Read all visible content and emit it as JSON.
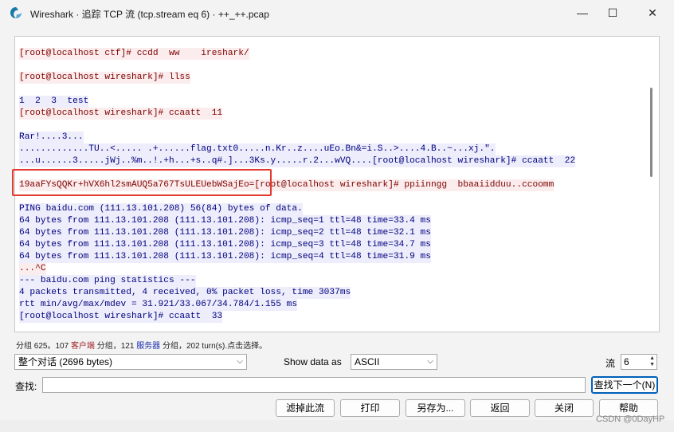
{
  "window": {
    "title": "Wireshark · 追踪 TCP 流 (tcp.stream eq 6) · ++_++.pcap",
    "minimize_glyph": "—",
    "maximize_glyph": "☐",
    "close_glyph": "✕"
  },
  "stream": {
    "lines": [
      {
        "text": "[root@localhost ctf]# ccdd  ww    ireshark/",
        "side": "client"
      },
      {
        "text": "[root@localhost wireshark]# llss",
        "side": "client"
      },
      {
        "text": "1  2  3  test",
        "side": "server"
      },
      {
        "text": "[root@localhost wireshark]# ccaatt  11",
        "side": "client"
      },
      {
        "text": "Rar!....3...",
        "side": "server"
      },
      {
        "text": ".............TU..<..... .+......flag.txt0.....n.Kr..z....uEo.Bn&=i.S..>....4.B..~...xj.\".",
        "side": "server"
      },
      {
        "text": "...u......3.....jWj..%m..!.+h...+s..q#.]...3Ks.y.....r.2...wVQ....[root@localhost wireshark]# ccaatt  22",
        "side": "server"
      },
      {
        "text": "19aaFYsQQKr+hVX6hl2smAUQ5a767TsULEUebWSajEo=[root@localhost wireshark]# ppiinngg  bbaaiidduu..ccoomm",
        "side": "client"
      },
      {
        "text": "PING baidu.com (111.13.101.208) 56(84) bytes of data.",
        "side": "server"
      },
      {
        "text": "64 bytes from 111.13.101.208 (111.13.101.208): icmp_seq=1 ttl=48 time=33.4 ms",
        "side": "server"
      },
      {
        "text": "64 bytes from 111.13.101.208 (111.13.101.208): icmp_seq=2 ttl=48 time=32.1 ms",
        "side": "server"
      },
      {
        "text": "64 bytes from 111.13.101.208 (111.13.101.208): icmp_seq=3 ttl=48 time=34.7 ms",
        "side": "server"
      },
      {
        "text": "64 bytes from 111.13.101.208 (111.13.101.208): icmp_seq=4 ttl=48 time=31.9 ms",
        "side": "server"
      },
      {
        "text": "...^C",
        "side": "client"
      },
      {
        "text": "--- baidu.com ping statistics ---",
        "side": "server"
      },
      {
        "text": "4 packets transmitted, 4 received, 0% packet loss, time 3037ms",
        "side": "server"
      },
      {
        "text": "rtt min/avg/max/mdev = 31.921/33.067/34.784/1.155 ms",
        "side": "server"
      },
      {
        "text": "[root@localhost wireshark]# ccaatt  33",
        "side": "server"
      }
    ]
  },
  "status": {
    "part1": "分组 625。107 ",
    "client": "客户端",
    "part2": " 分组，121 ",
    "server": "服务器",
    "part3": " 分组，202 turn(s).点击选择。"
  },
  "controls": {
    "conversation_select": "整个对话 (2696 bytes)",
    "show_data_label": "Show data as",
    "show_data_value": "ASCII",
    "stream_label": "流",
    "stream_value": "6",
    "find_label": "查找:",
    "find_value": "",
    "find_next_label": "查找下一个(N)"
  },
  "buttons": {
    "filter_out": "滤掉此流",
    "print": "打印",
    "save_as": "另存为...",
    "back": "返回",
    "close": "关闭",
    "help": "帮助"
  },
  "footer": {
    "watermark": "CSDN @0DayHP"
  },
  "colors": {
    "client_fg": "#7f0000",
    "client_bg": "#fbeded",
    "server_fg": "#00007f",
    "server_bg": "#ededfb",
    "highlight": "#e23a2e"
  }
}
